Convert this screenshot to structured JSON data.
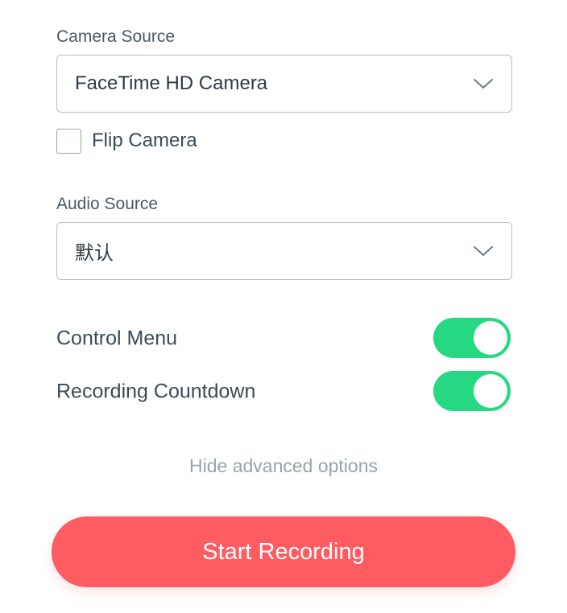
{
  "camera": {
    "label": "Camera Source",
    "selected": "FaceTime HD Camera",
    "dropdown_icon": "chevron-down-icon",
    "flip_label": "Flip Camera",
    "flip_checked": false
  },
  "audio": {
    "label": "Audio Source",
    "selected": "默认",
    "dropdown_icon": "chevron-down-icon"
  },
  "toggles": [
    {
      "label": "Control Menu",
      "on": true
    },
    {
      "label": "Recording Countdown",
      "on": true
    }
  ],
  "advanced_link": "Hide advanced options",
  "start_button": "Start Recording",
  "colors": {
    "accent_red": "#fd5c63",
    "toggle_green": "#26d882",
    "text": "#3c4a57",
    "muted_text": "#9aa2ab",
    "border": "#b7bec6"
  }
}
